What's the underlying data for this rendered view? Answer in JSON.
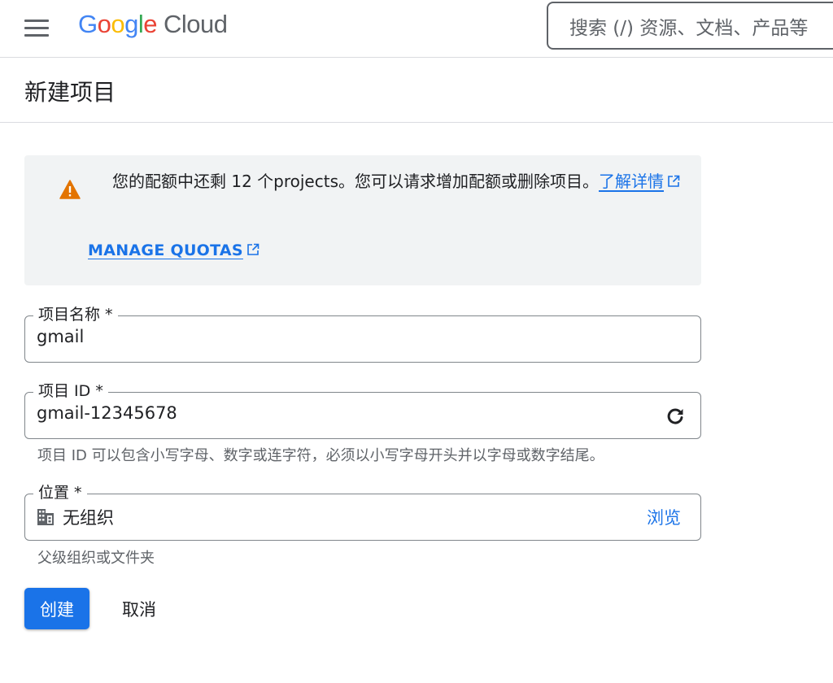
{
  "header": {
    "logo_google": [
      "G",
      "o",
      "o",
      "g",
      "l",
      "e"
    ],
    "logo_cloud": "Cloud",
    "search_placeholder": "搜索 (/) 资源、文档、产品等"
  },
  "page": {
    "title": "新建项目"
  },
  "banner": {
    "message": "您的配额中还剩 12 个projects。您可以请求增加配额或删除项目。",
    "learn_more": "了解详情",
    "manage_quotas": "MANAGE QUOTAS"
  },
  "form": {
    "project_name": {
      "label": "项目名称 *",
      "value": "gmail"
    },
    "project_id": {
      "label": "项目 ID *",
      "value": "gmail-12345678",
      "helper": "项目 ID 可以包含小写字母、数字或连字符，必须以小写字母开头并以字母或数字结尾。"
    },
    "location": {
      "label": "位置 *",
      "value": "无组织",
      "browse": "浏览",
      "helper": "父级组织或文件夹"
    }
  },
  "actions": {
    "create": "创建",
    "cancel": "取消"
  },
  "colors": {
    "accent": "#1a73e8",
    "warning": "#e37400"
  }
}
